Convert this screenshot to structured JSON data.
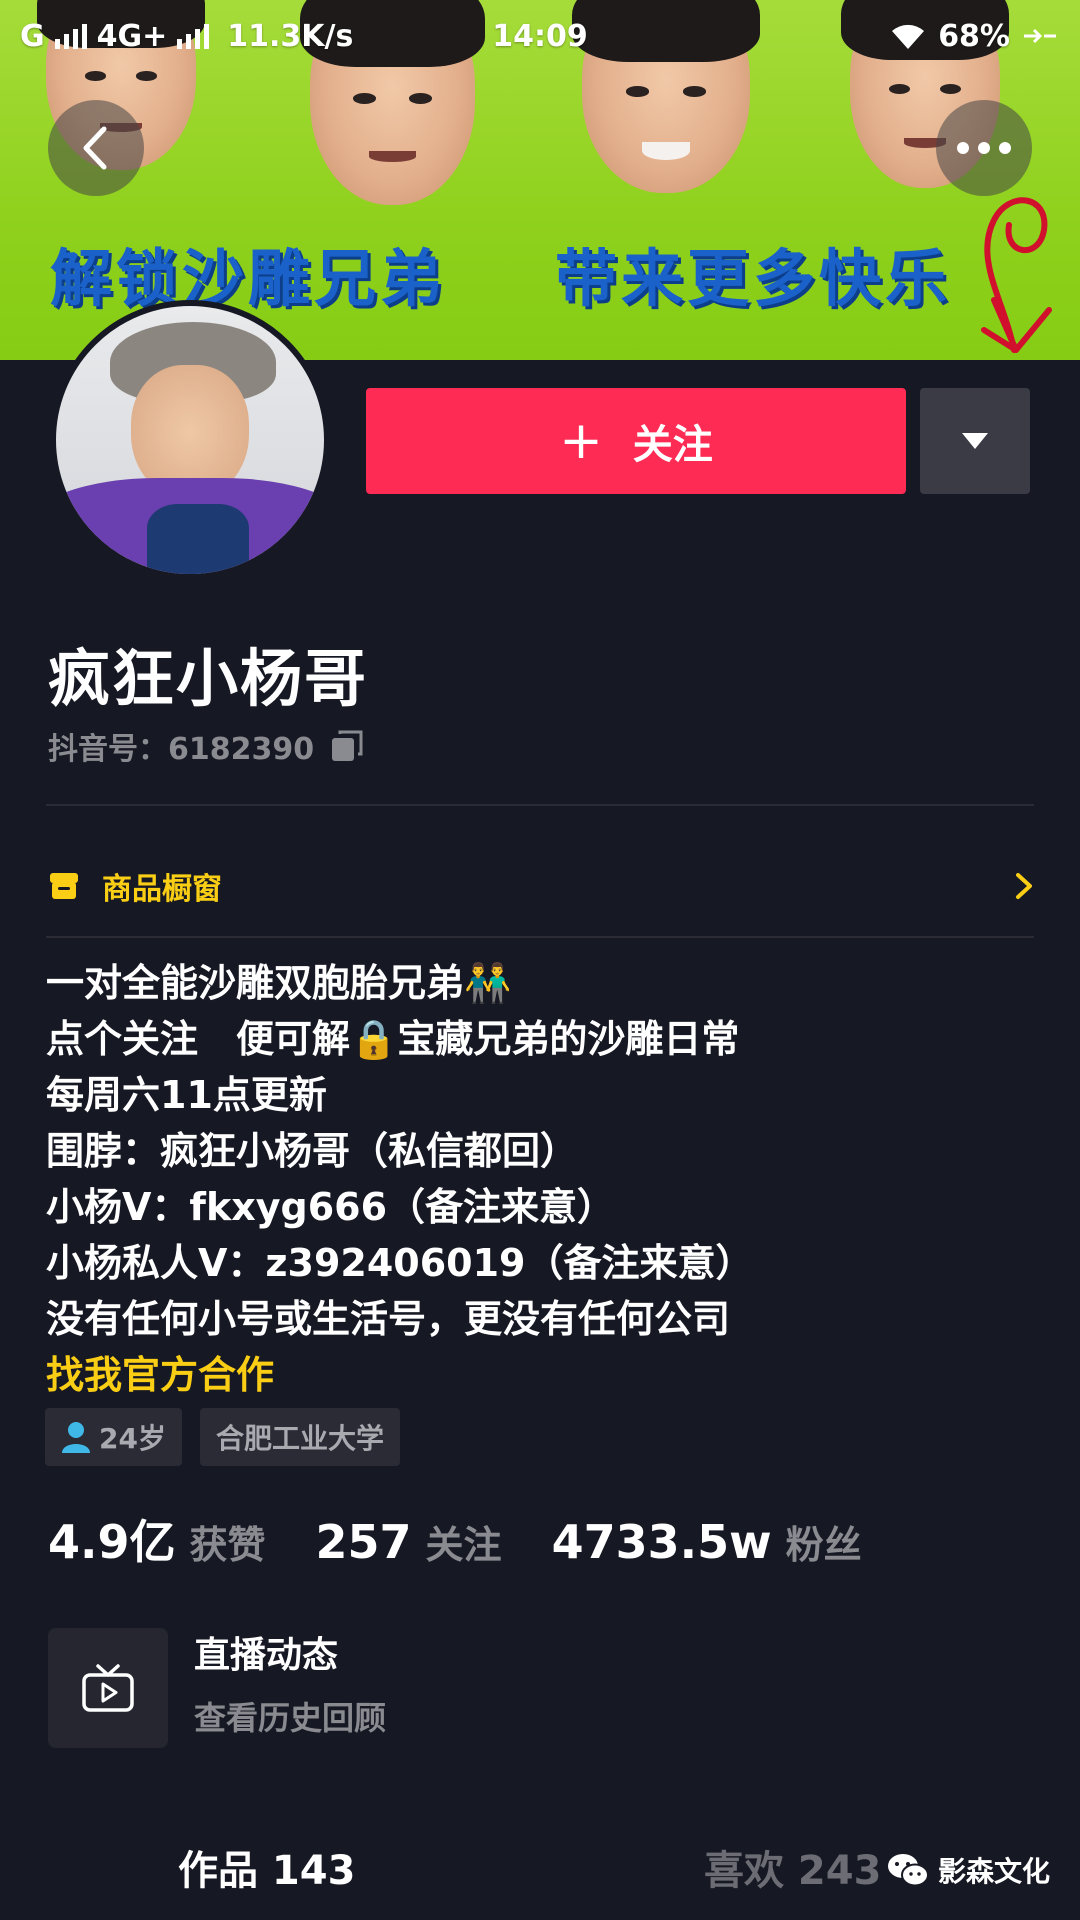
{
  "status_bar": {
    "carrier": "G",
    "network": "4G+",
    "speed": "11.3K/s",
    "time": "14:09",
    "battery": "68%"
  },
  "banner": {
    "text_left": "解锁沙雕兄弟",
    "text_right": "带来更多快乐"
  },
  "header": {
    "back_icon": "chevron-left-icon",
    "more_icon": "ellipsis-icon"
  },
  "profile": {
    "follow_label": "关注",
    "name": "疯狂小杨哥",
    "douyin_id": "抖音号：6182390"
  },
  "shop": {
    "label": "商品橱窗"
  },
  "bio": {
    "lines": [
      "一对全能沙雕双胞胎兄弟👬",
      "点个关注　便可解🔒宝藏兄弟的沙雕日常",
      "每周六11点更新",
      "围脖：疯狂小杨哥（私信都回）",
      "小杨V：fkxyg666（备注来意）",
      "小杨私人V：z392406019（备注来意）",
      "没有任何小号或生活号，更没有任何公司"
    ],
    "link": "找我官方合作"
  },
  "tags": {
    "age": "24岁",
    "school": "合肥工业大学"
  },
  "stats": {
    "likes_num": "4.9亿",
    "likes_label": "获赞",
    "following_num": "257",
    "following_label": "关注",
    "fans_num": "4733.5w",
    "fans_label": "粉丝"
  },
  "live": {
    "title": "直播动态",
    "subtitle": "查看历史回顾"
  },
  "tabs": {
    "works": "作品 143",
    "likes": "喜欢 243"
  },
  "watermark": {
    "text": "影森文化"
  },
  "colors": {
    "background": "#161823",
    "follow_red": "#fe2c55",
    "accent_yellow": "#face15",
    "muted_text": "#8a8b91",
    "banner_green": "#8fd11d",
    "banner_text_blue": "#1a62c9"
  }
}
